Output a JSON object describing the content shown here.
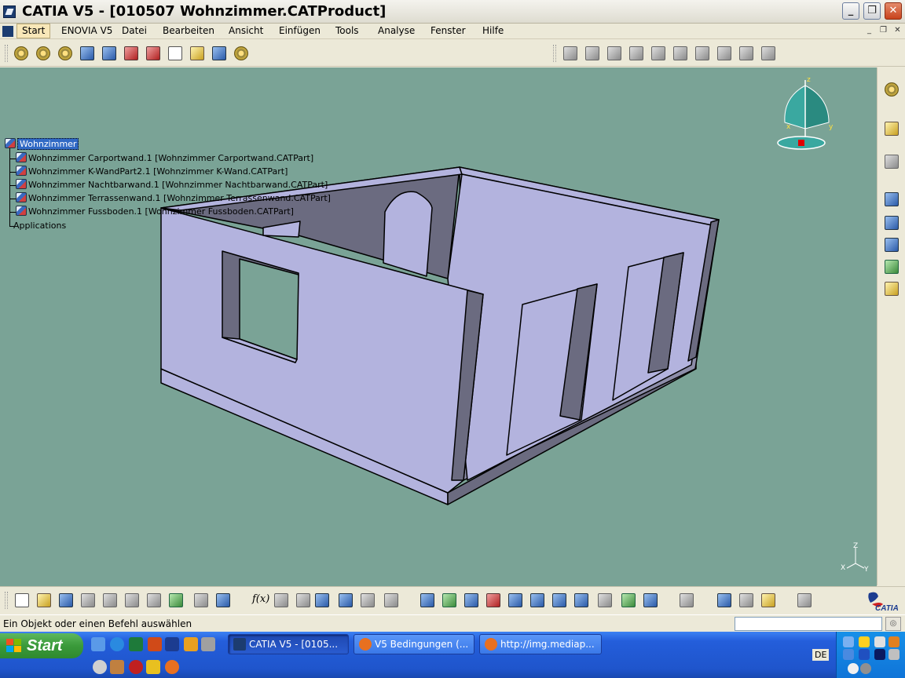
{
  "window": {
    "title": "CATIA V5 - [010507 Wohnzimmer.CATProduct]",
    "controls": {
      "minimize": "_",
      "maximize": "❐",
      "close": "✕"
    }
  },
  "menu": {
    "items": [
      "Start",
      "ENOVIA V5",
      "Datei",
      "Bearbeiten",
      "Ansicht",
      "Einfügen",
      "Tools",
      "Analyse",
      "Fenster",
      "Hilfe"
    ],
    "active": "Start",
    "mdi_controls": [
      "_",
      "❐",
      "✕"
    ]
  },
  "spec_tree": {
    "root": "Wohnzimmer",
    "children": [
      "Wohnzimmer Carportwand.1 [Wohnzimmer Carportwand.CATPart]",
      "Wohnzimmer K-WandPart2.1 [Wohnzimmer K-Wand.CATPart]",
      "Wohnzimmer Nachtbarwand.1 [Wohnzimmer Nachtbarwand.CATPart]",
      "Wohnzimmer Terrassenwand.1 [Wohnzimmer Terrassenwand.CATPart]",
      "Wohnzimmer Fussboden.1 [Wohnzimmer Fussboden.CATPart]"
    ],
    "applications": "Applications"
  },
  "compass": {
    "axis_z": "z",
    "axis_x": "x",
    "axis_y": "y"
  },
  "axis_triad": {
    "z": "Z",
    "x": "X",
    "y": "Y"
  },
  "toolbar_bottom": {
    "fx_label": "f(x)"
  },
  "brand": {
    "logo_text": "CATIA"
  },
  "status": {
    "message": "Ein Objekt oder einen Befehl auswählen"
  },
  "taskbar": {
    "start_label": "Start",
    "tasks": [
      {
        "label": "CATIA V5 - [0105...",
        "active": true
      },
      {
        "label": "V5 Bedingungen (...",
        "active": false
      },
      {
        "label": "http://img.mediap...",
        "active": false
      }
    ],
    "language": "DE"
  },
  "colors": {
    "viewport_bg": "#7aa396",
    "wall_light": "#b3b3de",
    "wall_dark": "#6b6b80",
    "wall_mid": "#8c8ca8",
    "taskbar_blue": "#245edb",
    "start_green": "#3a9a3a"
  }
}
